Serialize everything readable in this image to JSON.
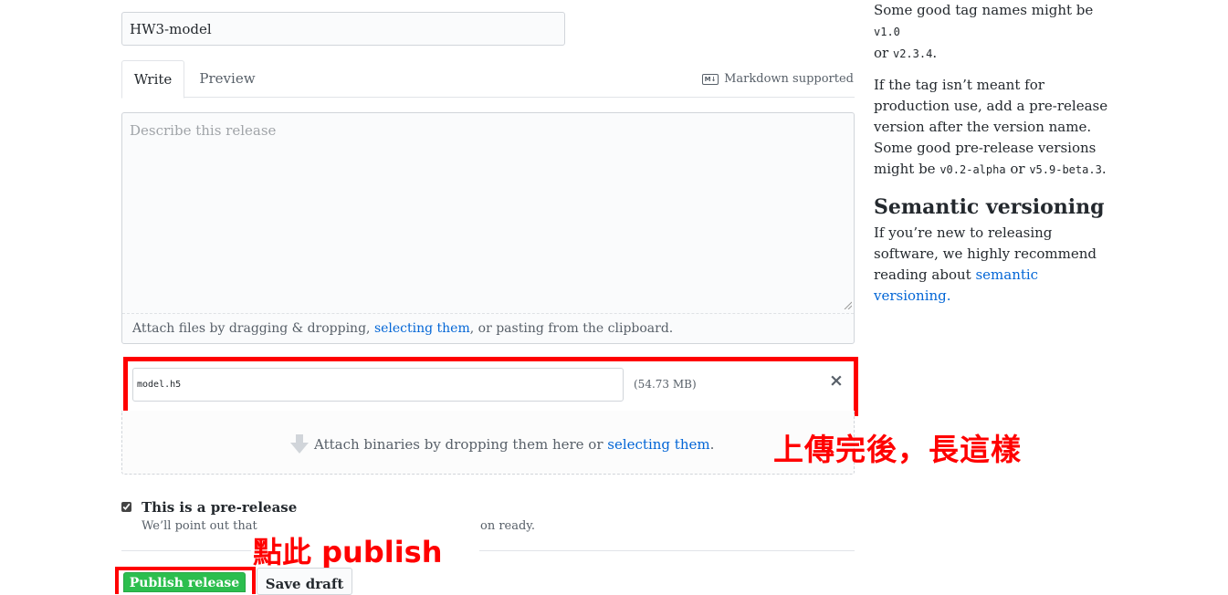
{
  "release_form": {
    "title_value": "HW3-model",
    "tabs": {
      "write": "Write",
      "preview": "Preview"
    },
    "markdown_icon_text": "M↓",
    "markdown_hint": "Markdown supported",
    "description_placeholder": "Describe this release",
    "attach_prefix": "Attach files by dragging & dropping, ",
    "attach_link": "selecting them",
    "attach_suffix": ", or pasting from the clipboard.",
    "uploaded_file": {
      "name": "model.h5",
      "size": "(54.73 MB)",
      "remove_icon": "×"
    },
    "binaries_prefix": "Attach binaries by dropping them here or ",
    "binaries_link": "selecting them",
    "binaries_suffix": ".",
    "prerelease": {
      "label": "This is a pre-release",
      "checked": true,
      "note_visible_start": "We’ll point out that",
      "note_visible_end": "on ready."
    },
    "buttons": {
      "publish": "Publish release",
      "save_draft": "Save draft"
    }
  },
  "annotations": {
    "uploaded_note": "上傳完後，長這樣",
    "click_note": "點此 publish",
    "highlight_color": "#ff0000"
  },
  "sidebar": {
    "tag_tip_prefix": "Some good tag names might be ",
    "tag_example_1": "v1.0",
    "tag_tip_or": "or ",
    "tag_example_2": "v2.3.4",
    "tag_tip_end": ".",
    "prerelease_tip": "If the tag isn’t meant for production use, add a pre-release version after the version name. Some good pre-release versions might be ",
    "prerelease_example_1": "v0.2-alpha",
    "prerelease_or": " or ",
    "prerelease_example_2": "v5.9-beta.3",
    "prerelease_end": ".",
    "semver_heading": "Semantic versioning",
    "semver_text": "If you’re new to releasing software, we highly recommend reading about ",
    "semver_link": "semantic versioning."
  },
  "colors": {
    "link": "#0366d6",
    "publish_green": "#2cbe4e",
    "annotation_red": "#ff0000"
  },
  "icons": [
    "markdown-icon",
    "close-icon",
    "download-arrow-icon",
    "checkbox-icon"
  ]
}
